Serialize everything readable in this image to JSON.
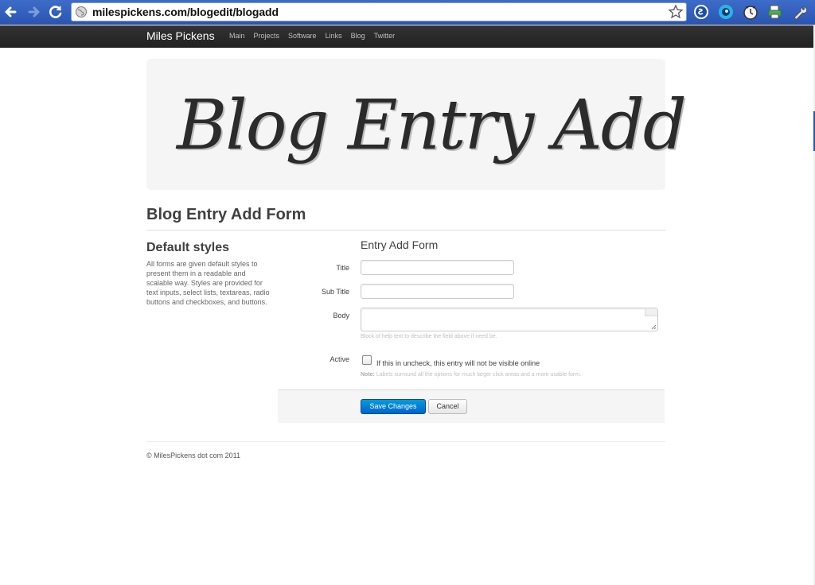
{
  "browser": {
    "url": "milespickens.com/blogedit/blogadd",
    "extensions": [
      "skype-icon",
      "blue-circle-icon",
      "clock-icon",
      "printer-icon",
      "wrench-icon"
    ]
  },
  "topbar": {
    "brand": "Miles Pickens",
    "nav": [
      "Main",
      "Projects",
      "Software",
      "Links",
      "Blog",
      "Twitter"
    ]
  },
  "hero": {
    "title": "Blog Entry Add"
  },
  "page": {
    "header": "Blog Entry Add Form"
  },
  "sidebar": {
    "title": "Default styles",
    "text": "All forms are given default styles to present them in a readable and scalable way. Styles are provided for text inputs, select lists, textareas, radio buttons and checkboxes, and buttons."
  },
  "form": {
    "legend": "Entry Add Form",
    "title_label": "Title",
    "subtitle_label": "Sub Title",
    "body_label": "Body",
    "body_help": "Block of help text to describe the field above if need be.",
    "active_label": "Active",
    "active_checkbox_label": "If this in uncheck, this entry will not be visible online",
    "note_prefix": "Note:",
    "note_text": "Labels surround all the options for much larger click areas and a more usable form.",
    "save_label": "Save Changes",
    "cancel_label": "Cancel"
  },
  "footer": {
    "text": "© MilesPickens dot com 2011"
  },
  "colors": {
    "chrome": "#2a56b2",
    "topbar": "#222222",
    "primary": "#0064cd"
  }
}
